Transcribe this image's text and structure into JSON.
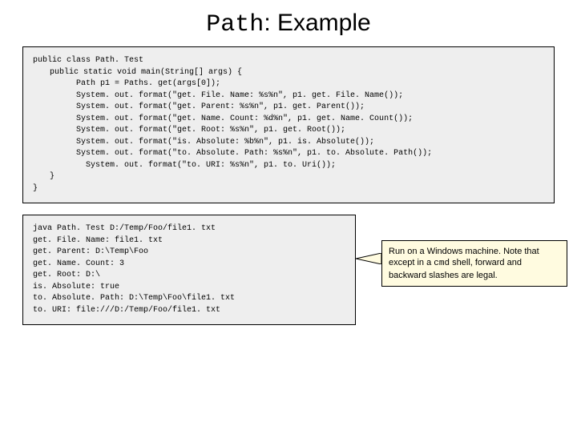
{
  "title_mono": "Path",
  "title_rest": ": Example",
  "code": {
    "l0": "public class Path. Test",
    "l1": "public static void main(String[] args) {",
    "l2": "Path p1 = Paths. get(args[0]);",
    "l3": "System. out. format(\"get. File. Name: %s%n\", p1. get. File. Name());",
    "l4": "System. out. format(\"get. Parent: %s%n\", p1. get. Parent());",
    "l5": "System. out. format(\"get. Name. Count: %d%n\", p1. get. Name. Count());",
    "l6": "System. out. format(\"get. Root: %s%n\", p1. get. Root());",
    "l7": "System. out. format(\"is. Absolute: %b%n\", p1. is. Absolute());",
    "l8": "System. out. format(\"to. Absolute. Path: %s%n\", p1. to. Absolute. Path());",
    "l9": "System. out. format(\"to. URI: %s%n\", p1. to. Uri());",
    "l10": "}",
    "l11": "}"
  },
  "output": {
    "o0": "java Path. Test D:/Temp/Foo/file1. txt",
    "o1": "get. File. Name: file1. txt",
    "o2": "get. Parent: D:\\Temp\\Foo",
    "o3": "get. Name. Count: 3",
    "o4": "get. Root: D:\\",
    "o5": "is. Absolute: true",
    "o6": "to. Absolute. Path: D:\\Temp\\Foo\\file1. txt",
    "o7": "to. URI: file:///D:/Temp/Foo/file1. txt"
  },
  "callout": {
    "prefix": "Run on a Windows machine. Note that except in a ",
    "cmd": "cmd",
    "suffix": " shell, forward and backward slashes are legal."
  }
}
